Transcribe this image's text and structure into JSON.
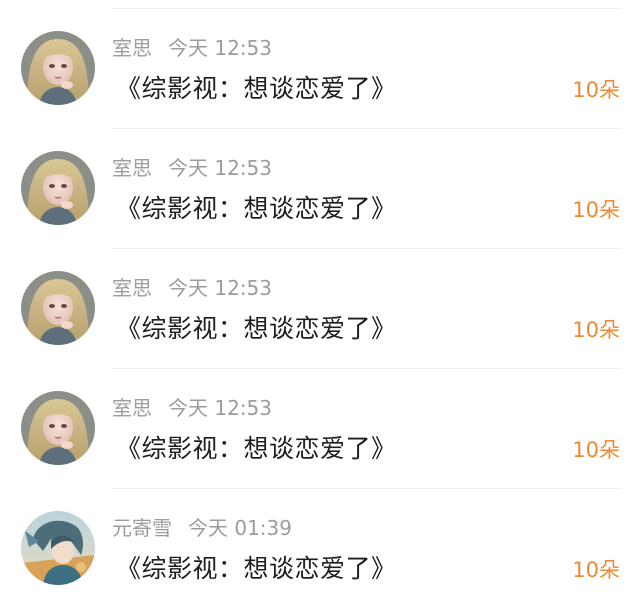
{
  "rows": [
    {
      "user": "室思",
      "time": "今天 12:53",
      "text": "《综影视：想谈恋爱了》",
      "count": "10朵",
      "avatar_icon": "blonde-girl-avatar"
    },
    {
      "user": "室思",
      "time": "今天 12:53",
      "text": "《综影视：想谈恋爱了》",
      "count": "10朵",
      "avatar_icon": "blonde-girl-avatar"
    },
    {
      "user": "室思",
      "time": "今天 12:53",
      "text": "《综影视：想谈恋爱了》",
      "count": "10朵",
      "avatar_icon": "blonde-girl-avatar"
    },
    {
      "user": "室思",
      "time": "今天 12:53",
      "text": "《综影视：想谈恋爱了》",
      "count": "10朵",
      "avatar_icon": "blonde-girl-avatar"
    },
    {
      "user": "元寄雪",
      "time": "今天 01:39",
      "text": "《综影视：想谈恋爱了》",
      "count": "10朵",
      "avatar_icon": "anime-boy-avatar"
    }
  ],
  "colors": {
    "username": "#9c9c9c",
    "text": "#1e1e1e",
    "count": "#ef8a36",
    "divider": "#f0f0f0"
  }
}
